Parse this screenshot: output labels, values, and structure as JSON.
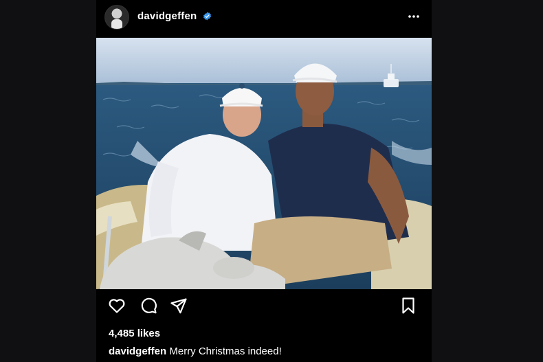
{
  "post": {
    "username": "davidgeffen",
    "likes": "4,485 likes",
    "caption_user": "davidgeffen",
    "caption_text": " Merry Christmas indeed!"
  },
  "icons": {
    "verified": "verified-badge-icon",
    "more": "more-options-icon",
    "like": "heart-icon",
    "comment": "comment-icon",
    "share": "share-icon",
    "save": "bookmark-icon"
  },
  "colors": {
    "background": "#000000",
    "verified": "#3897f0",
    "text": "#ffffff"
  }
}
